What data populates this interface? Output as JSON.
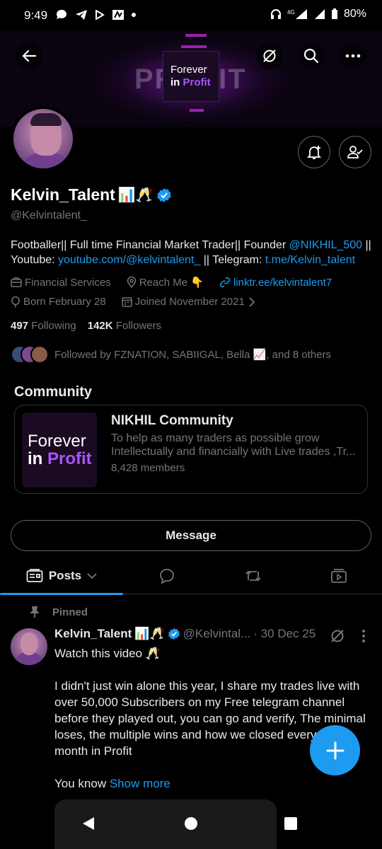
{
  "status_bar": {
    "time": "9:49",
    "network": "4G",
    "battery": "80%"
  },
  "banner": {
    "big_text": "PROFIT",
    "card_line1": "Forever",
    "card_line2_a": "in ",
    "card_line2_b": "Profit"
  },
  "profile": {
    "name": "Kelvin_Talent",
    "name_emoji": "📊🥂",
    "handle": "@Kelvintalent_",
    "bio_line1_a": "Footballer|| Full time Financial Market Trader|| Founder ",
    "bio_line1_link": "@NIKHIL_500",
    "bio_line1_b": " ||",
    "bio_line2_a": "Youtube: ",
    "bio_line2_link1": "youtube.com/@kelvintalent_",
    "bio_line2_b": " || Telegram: ",
    "bio_line2_link2": "t.me/Kelvin_talent",
    "category": "Financial Services",
    "location": "Reach Me 👇",
    "website": "linktr.ee/kelvintalent7",
    "birthday": "Born February 28",
    "joined": "Joined November 2021",
    "following_count": "497",
    "following_label": "Following",
    "followers_count": "142K",
    "followers_label": "Followers",
    "followed_by": "Followed by FZNATION, SABIIGAL, Bella 📈, and 8 others"
  },
  "community": {
    "section_title": "Community",
    "thumb_line1": "Forever",
    "thumb_line2_a": "in ",
    "thumb_line2_b": "Profit",
    "title": "NIKHIL Community",
    "desc_line1": "To help as many traders as possible grow",
    "desc_line2": "Intellectually and financially with Live trades ,Tr...",
    "members": "8,428 members"
  },
  "message_button": "Message",
  "tabs": {
    "posts": "Posts"
  },
  "pinned_post": {
    "pinned_label": "Pinned",
    "author": "Kelvin_Talent",
    "author_emoji": "📊🥂",
    "handle": "@Kelvintal...",
    "date": "· 30 Dec 25",
    "line1": "Watch this video 🥂",
    "para": "I didn't just win alone this year, I share my trades live with over 50,000 Subscribers on my Free telegram channel before they played out, you can go and verify, The minimal loses, the multiple wins and how we closed every single month in Profit",
    "line_last": "You know ",
    "show_more": "Show more"
  },
  "colors": {
    "accent": "#1d9bf0",
    "background": "#000000",
    "muted": "#71767b",
    "purple": "#a855f7"
  }
}
